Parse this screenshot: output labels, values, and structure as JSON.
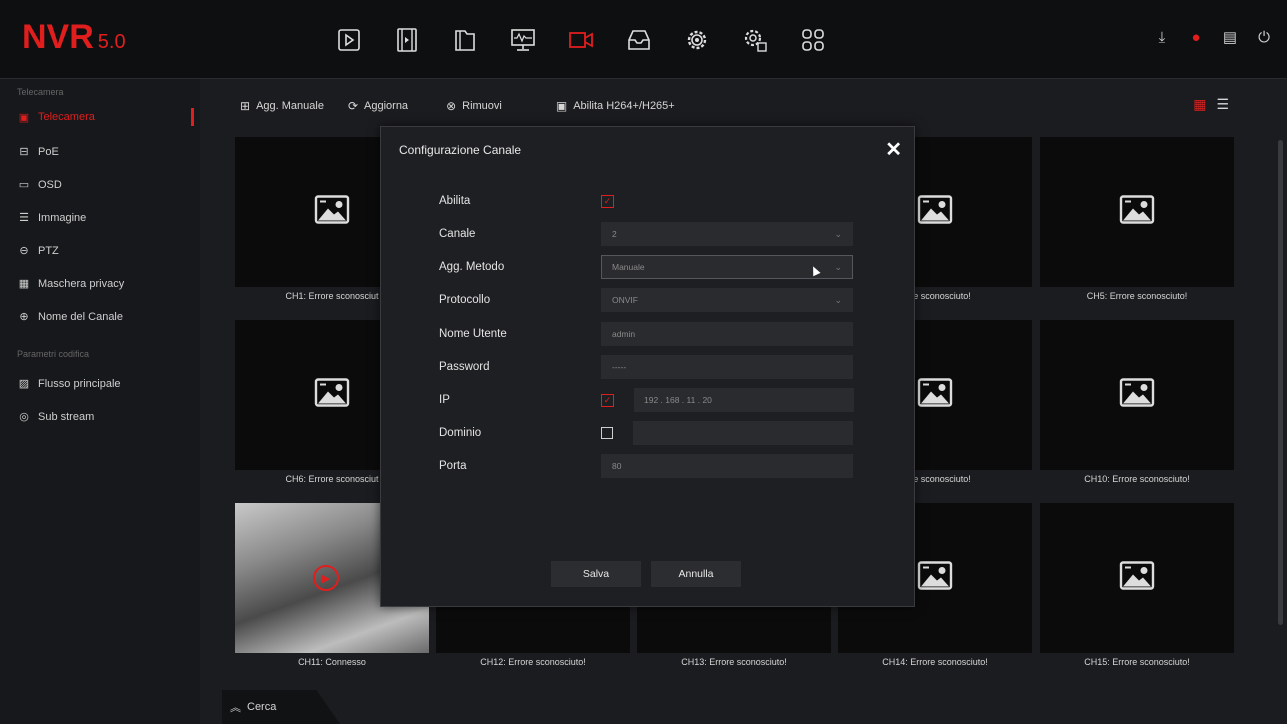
{
  "app": {
    "logo_main": "NVR",
    "logo_version": "5.0"
  },
  "topnav": {
    "icons": [
      "play-icon",
      "film-icon",
      "folder-icon",
      "monitor-icon",
      "camera-icon",
      "inbox-icon",
      "gear-icon",
      "advanced-gear-icon",
      "apps-icon"
    ],
    "active": "camera-icon",
    "right": [
      "download-icon",
      "alarm-icon",
      "disk-icon",
      "power-icon"
    ]
  },
  "sidebar": {
    "section1": "Telecamera",
    "items1": [
      {
        "label": "Telecamera",
        "icon": "camera-small-icon",
        "active": true
      },
      {
        "label": "PoE",
        "icon": "poe-icon"
      },
      {
        "label": "OSD",
        "icon": "osd-icon"
      },
      {
        "label": "Immagine",
        "icon": "image-icon"
      },
      {
        "label": "PTZ",
        "icon": "ptz-icon"
      },
      {
        "label": "Maschera privacy",
        "icon": "privacy-mask-icon"
      },
      {
        "label": "Nome del Canale",
        "icon": "channel-name-icon"
      }
    ],
    "section2": "Parametri codifica",
    "items2": [
      {
        "label": "Flusso principale",
        "icon": "main-stream-icon"
      },
      {
        "label": "Sub stream",
        "icon": "sub-stream-icon"
      }
    ]
  },
  "toolbar": {
    "add_manual": "Agg. Manuale",
    "refresh": "Aggiorna",
    "remove": "Rimuovi",
    "enable_h264": "Abilita H264+/H265+"
  },
  "grid": {
    "captions": [
      "CH1: Errore sconosciut",
      "",
      "",
      "rrore sconosciuto!",
      "CH5: Errore sconosciuto!",
      "CH6: Errore sconosciut",
      "",
      "",
      "rrore sconosciuto!",
      "CH10: Errore sconosciuto!",
      "CH11: Connesso",
      "CH12: Errore sconosciuto!",
      "CH13: Errore sconosciuto!",
      "CH14: Errore sconosciuto!",
      "CH15: Errore sconosciuto!"
    ]
  },
  "search": {
    "label": "Cerca"
  },
  "modal": {
    "title": "Configurazione Canale",
    "close": "✕",
    "abilita_label": "Abilita",
    "abilita_checked": true,
    "canale_label": "Canale",
    "canale_value": "2",
    "metodo_label": "Agg. Metodo",
    "metodo_value": "Manuale",
    "protocollo_label": "Protocollo",
    "protocollo_value": "ONVIF",
    "utente_label": "Nome Utente",
    "utente_value": "admin",
    "password_label": "Password",
    "password_value": "-----",
    "ip_label": "IP",
    "ip_checked": true,
    "ip_value": "192  .  168  .  11  .  20",
    "dominio_label": "Dominio",
    "dominio_checked": false,
    "porta_label": "Porta",
    "porta_value": "80",
    "save": "Salva",
    "cancel": "Annulla"
  }
}
